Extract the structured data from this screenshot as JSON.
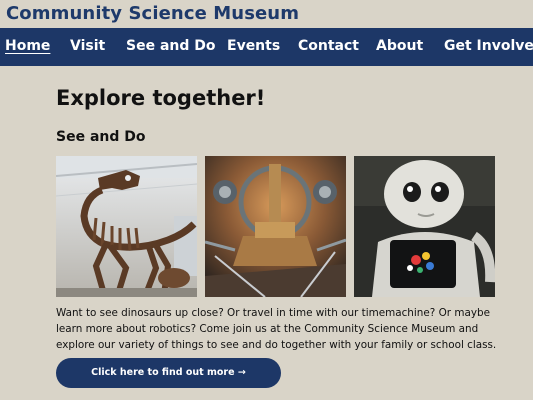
{
  "header": {
    "site_title": "Community Science Museum"
  },
  "nav": {
    "items": [
      {
        "label": "Home",
        "active": true
      },
      {
        "label": "Visit"
      },
      {
        "label": "See and Do"
      },
      {
        "label": "Events"
      },
      {
        "label": "Contact"
      },
      {
        "label": "About"
      },
      {
        "label": "Get Involved"
      }
    ]
  },
  "main": {
    "heading": "Explore together!",
    "section_heading": "See and Do",
    "images": [
      {
        "name": "dinosaur-skeleton-photo"
      },
      {
        "name": "timemachine-interior-photo"
      },
      {
        "name": "robot-photo"
      }
    ],
    "description": "Want to see dinosaurs up close? Or travel in time with our timemachine? Or maybe learn more about robotics? Come join us at the Community Science Museum and explore our variety of things to see and do together with your family or school class.",
    "cta_label": "Click here to find out more",
    "cta_icon": "arrow-right-icon"
  },
  "colors": {
    "background": "#d9d4c8",
    "brand_navy": "#1d3767",
    "title_blue": "#1e3a6b"
  }
}
